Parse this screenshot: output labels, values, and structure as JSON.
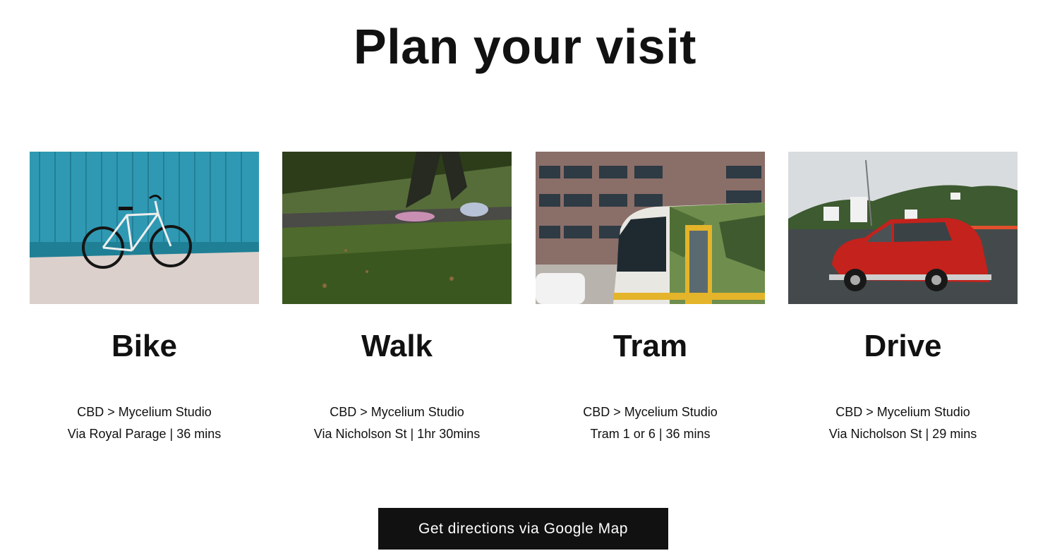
{
  "page": {
    "title": "Plan your visit"
  },
  "cards": [
    {
      "title": "Bike",
      "route": "CBD > Mycelium Studio",
      "detail": "Via Royal Parage | 36 mins",
      "image_icon": "bicycle-photo"
    },
    {
      "title": "Walk",
      "route": "CBD > Mycelium Studio",
      "detail": "Via Nicholson St | 1hr 30mins",
      "image_icon": "walking-photo"
    },
    {
      "title": "Tram",
      "route": "CBD > Mycelium Studio",
      "detail": "Tram 1 or 6 | 36 mins",
      "image_icon": "tram-photo"
    },
    {
      "title": "Drive",
      "route": "CBD > Mycelium Studio",
      "detail": "Via Nicholson St | 29 mins",
      "image_icon": "car-photo"
    }
  ],
  "cta": {
    "label": "Get directions via Google Map"
  },
  "colors": {
    "text": "#111111",
    "button_bg": "#111111",
    "button_text": "#ffffff",
    "background": "#ffffff"
  }
}
